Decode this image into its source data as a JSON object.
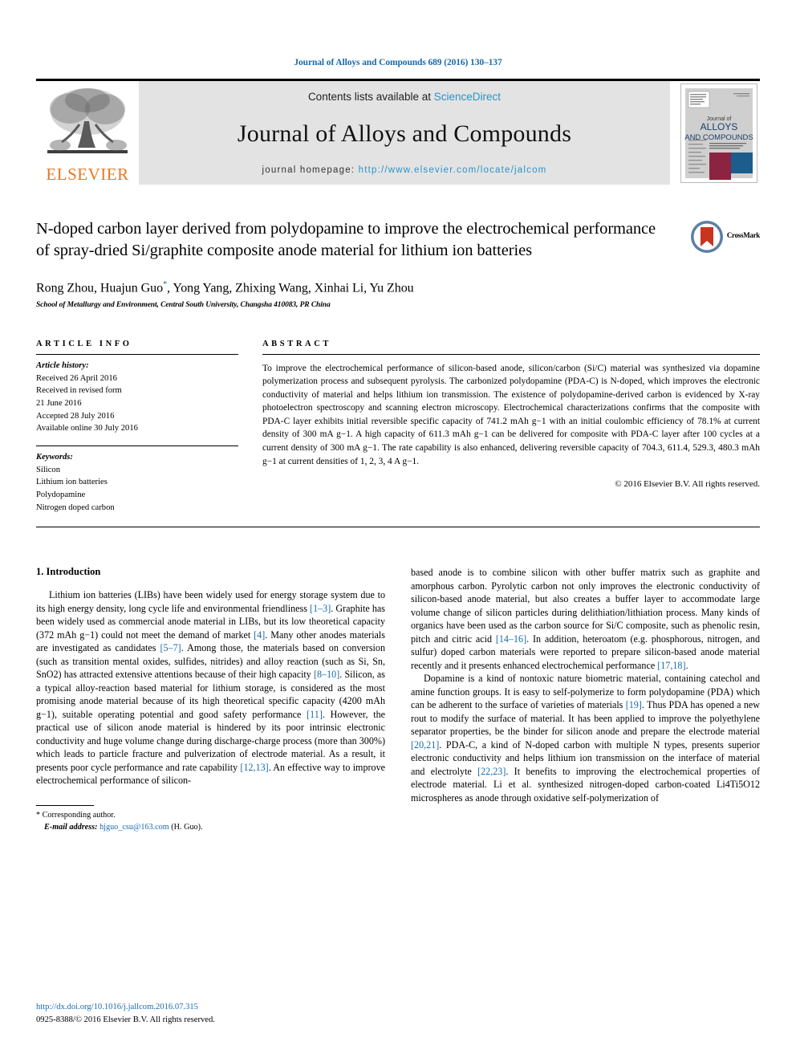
{
  "running_head": "Journal of Alloys and Compounds 689 (2016) 130–137",
  "masthead": {
    "publisher_name": "ELSEVIER",
    "contents_prefix": "Contents lists available at ",
    "contents_link": "ScienceDirect",
    "journal_name": "Journal of Alloys and Compounds",
    "homepage_prefix": "journal homepage: ",
    "homepage_url": "http://www.elsevier.com/locate/jalcom",
    "cover_title_line1": "Journal of",
    "cover_title_line2": "ALLOYS",
    "cover_title_line3": "AND COMPOUNDS",
    "colors": {
      "elsevier_orange": "#E87722",
      "link_blue": "#2a93c9",
      "band_gray": "#e3e3e3",
      "cover_red": "#8c2340",
      "cover_blue": "#1c5d8c"
    }
  },
  "article": {
    "title": "N-doped carbon layer derived from polydopamine to improve the electrochemical performance of spray-dried Si/graphite composite anode material for lithium ion batteries",
    "authors": "Rong Zhou, Huajun Guo",
    "authors_rest": ", Yong Yang, Zhixing Wang, Xinhai Li, Yu Zhou",
    "corresponding_marker": "*",
    "affiliation": "School of Metallurgy and Environment, Central South University, Changsha 410083, PR China",
    "crossmark_label": "CrossMark"
  },
  "article_info": {
    "heading": "ARTICLE INFO",
    "history_label": "Article history:",
    "history": [
      "Received 26 April 2016",
      "Received in revised form",
      "21 June 2016",
      "Accepted 28 July 2016",
      "Available online 30 July 2016"
    ],
    "keywords_label": "Keywords:",
    "keywords": [
      "Silicon",
      "Lithium ion batteries",
      "Polydopamine",
      "Nitrogen doped carbon"
    ]
  },
  "abstract": {
    "heading": "ABSTRACT",
    "text": "To improve the electrochemical performance of silicon-based anode, silicon/carbon (Si/C) material was synthesized via dopamine polymerization process and subsequent pyrolysis. The carbonized polydopamine (PDA-C) is N-doped, which improves the electronic conductivity of material and helps lithium ion transmission. The existence of polydopamine-derived carbon is evidenced by X-ray photoelectron spectroscopy and scanning electron microscopy. Electrochemical characterizations confirms that the composite with PDA-C layer exhibits initial reversible specific capacity of 741.2 mAh g−1 with an initial coulombic efficiency of 78.1% at current density of 300 mA g−1. A high capacity of 611.3 mAh g−1 can be delivered for composite with PDA-C layer after 100 cycles at a current density of 300 mA g−1. The rate capability is also enhanced, delivering reversible capacity of 704.3, 611.4, 529.3, 480.3 mAh g−1 at current densities of 1, 2, 3, 4 A g−1.",
    "copyright": "© 2016 Elsevier B.V. All rights reserved."
  },
  "introduction": {
    "heading": "1.  Introduction",
    "paragraph1_part1": "Lithium ion batteries (LIBs) have been widely used for energy storage system due to its high energy density, long cycle life and environmental friendliness ",
    "cite_1_3": "[1–3]",
    "paragraph1_part2": ". Graphite has been widely used as commercial anode material in LIBs, but its low theoretical capacity (372 mAh g−1) could not meet the demand of market ",
    "cite_4": "[4]",
    "paragraph1_part3": ". Many other anodes materials are investigated as candidates ",
    "cite_5_7": "[5–7]",
    "paragraph1_part4": ". Among those, the materials based on conversion (such as transition mental oxides, sulfides, nitrides) and alloy reaction (such as Si, Sn, SnO2) has attracted extensive attentions because of their high capacity ",
    "cite_8_10": "[8–10]",
    "paragraph1_part5": ". Silicon, as a typical alloy-reaction based material for lithium storage, is considered as the most promising anode material because of its high theoretical specific capacity (4200 mAh g−1), suitable operating potential and good safety performance ",
    "cite_11": "[11]",
    "paragraph1_part6": ". However, the practical use of silicon anode material is hindered by its poor intrinsic electronic conductivity and huge volume change during discharge-charge process (more than 300%) which leads to particle fracture and pulverization of electrode material. As a result, it presents poor cycle performance and rate capability ",
    "cite_12_13": "[12,13]",
    "paragraph1_part7": ". An effective way to improve electrochemical performance of silicon-",
    "paragraph2_part1": "based anode is to combine silicon with other buffer matrix such as graphite and amorphous carbon. Pyrolytic carbon not only improves the electronic conductivity of silicon-based anode material, but also creates a buffer layer to accommodate large volume change of silicon particles during delithiation/lithiation process. Many kinds of organics have been used as the carbon source for Si/C composite, such as phenolic resin, pitch and citric acid ",
    "cite_14_16": "[14–16]",
    "paragraph2_part2": ". In addition, heteroatom (e.g. phosphorous, nitrogen, and sulfur) doped carbon materials were reported to prepare silicon-based anode material recently and it presents enhanced electrochemical performance ",
    "cite_17_18": "[17,18]",
    "paragraph2_part3": ".",
    "paragraph3_part1": "Dopamine is a kind of nontoxic nature biometric material, containing catechol and amine function groups. It is easy to self-polymerize to form polydopamine (PDA) which can be adherent to the surface of varieties of materials ",
    "cite_19": "[19]",
    "paragraph3_part2": ". Thus PDA has opened a new rout to modify the surface of material. It has been applied to improve the polyethylene separator properties, be the binder for silicon anode and prepare the electrode material ",
    "cite_20_21": "[20,21]",
    "paragraph3_part3": ". PDA-C, a kind of N-doped carbon with multiple N types, presents superior electronic conductivity and helps lithium ion transmission on the interface of material and electrolyte ",
    "cite_22_23": "[22,23]",
    "paragraph3_part4": ". It benefits to improving the electrochemical properties of electrode material. Li et al. synthesized nitrogen-doped carbon-coated Li4Ti5O12 microspheres as anode through oxidative self-polymerization of"
  },
  "footnote": {
    "marker": "*",
    "corresponding": "Corresponding author.",
    "email_label": "E-mail address:",
    "email": "hjguo_csu@163.com",
    "email_suffix": "(H. Guo)."
  },
  "page_footer": {
    "doi": "http://dx.doi.org/10.1016/j.jallcom.2016.07.315",
    "issn_line": "0925-8388/© 2016 Elsevier B.V. All rights reserved."
  }
}
